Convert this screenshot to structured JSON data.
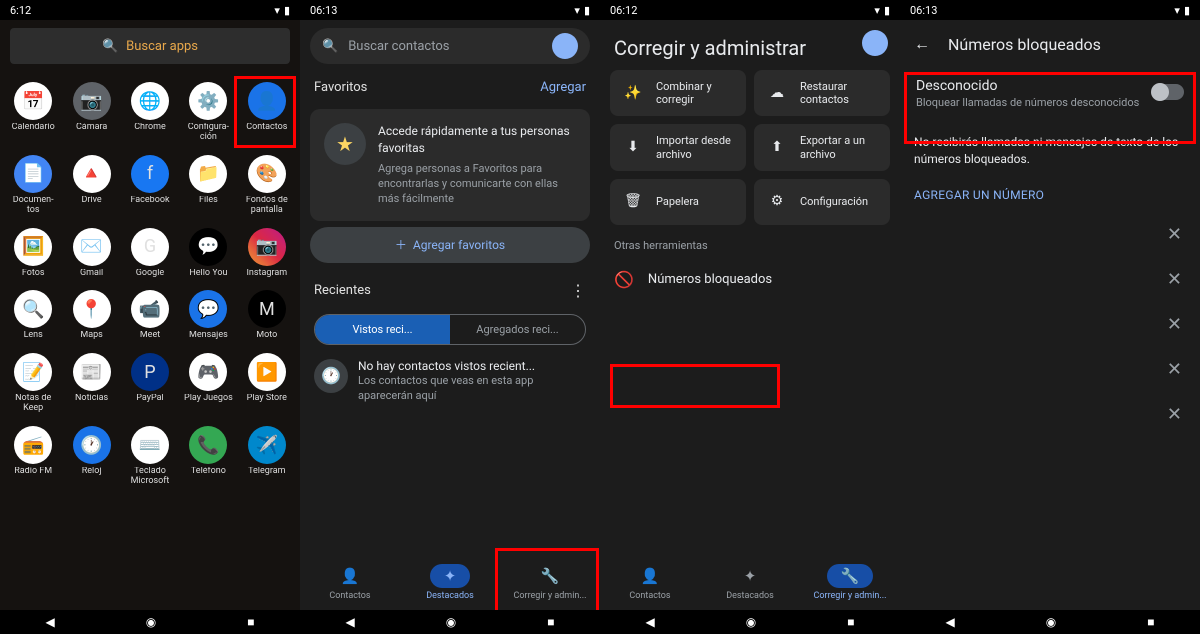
{
  "status": {
    "time1": "6:12",
    "time2": "06:13",
    "time3": "06:12",
    "time4": "06:13"
  },
  "p1": {
    "search": "Buscar apps",
    "apps": [
      {
        "label": "Calendario",
        "bg": "#fff",
        "emoji": "📅"
      },
      {
        "label": "Cámara",
        "bg": "#5f6368",
        "emoji": "📷"
      },
      {
        "label": "Chrome",
        "bg": "#fff",
        "emoji": "🌐"
      },
      {
        "label": "Configura-ción",
        "bg": "#fff",
        "emoji": "⚙️"
      },
      {
        "label": "Contactos",
        "bg": "#1a73e8",
        "emoji": "👤"
      },
      {
        "label": "Documen-tos",
        "bg": "#4285f4",
        "emoji": "📄"
      },
      {
        "label": "Drive",
        "bg": "#fff",
        "emoji": "🔺"
      },
      {
        "label": "Facebook",
        "bg": "#1877f2",
        "emoji": "f"
      },
      {
        "label": "Files",
        "bg": "#fff",
        "emoji": "📁"
      },
      {
        "label": "Fondos de pantalla",
        "bg": "#fff",
        "emoji": "🎨"
      },
      {
        "label": "Fotos",
        "bg": "#fff",
        "emoji": "🖼️"
      },
      {
        "label": "Gmail",
        "bg": "#fff",
        "emoji": "✉️"
      },
      {
        "label": "Google",
        "bg": "#fff",
        "emoji": "G"
      },
      {
        "label": "Hello You",
        "bg": "#000",
        "emoji": "💬"
      },
      {
        "label": "Instagram",
        "bg": "linear-gradient(45deg,#f09433,#e6683c,#dc2743,#cc2366,#bc1888)",
        "emoji": "📷"
      },
      {
        "label": "Lens",
        "bg": "#fff",
        "emoji": "🔍"
      },
      {
        "label": "Maps",
        "bg": "#fff",
        "emoji": "📍"
      },
      {
        "label": "Meet",
        "bg": "#fff",
        "emoji": "📹"
      },
      {
        "label": "Mensajes",
        "bg": "#1a73e8",
        "emoji": "💬"
      },
      {
        "label": "Moto",
        "bg": "#000",
        "emoji": "M"
      },
      {
        "label": "Notas de Keep",
        "bg": "#fff",
        "emoji": "📝"
      },
      {
        "label": "Noticias",
        "bg": "#fff",
        "emoji": "📰"
      },
      {
        "label": "PayPal",
        "bg": "#003087",
        "emoji": "P"
      },
      {
        "label": "Play Juegos",
        "bg": "#fff",
        "emoji": "🎮"
      },
      {
        "label": "Play Store",
        "bg": "#fff",
        "emoji": "▶️"
      },
      {
        "label": "Radio FM",
        "bg": "#fff",
        "emoji": "📻"
      },
      {
        "label": "Reloj",
        "bg": "#1a73e8",
        "emoji": "🕐"
      },
      {
        "label": "Teclado Microsoft",
        "bg": "#fff",
        "emoji": "⌨️"
      },
      {
        "label": "Teléfono",
        "bg": "#34a853",
        "emoji": "📞"
      },
      {
        "label": "Telegram",
        "bg": "#0088cc",
        "emoji": "✈️"
      }
    ]
  },
  "p2": {
    "search_placeholder": "Buscar contactos",
    "favorites": "Favoritos",
    "add": "Agregar",
    "fav_title": "Accede rápidamente a tus personas favoritas",
    "fav_sub": "Agrega personas a Favoritos para encontrarlas y comunicarte con ellas más fácilmente",
    "add_fav": "Agregar favoritos",
    "recent": "Recientes",
    "tab1": "Vistos reci...",
    "tab2": "Agregados reci...",
    "recent_title": "No hay contactos vistos recient...",
    "recent_sub": "Los contactos que veas en esta app aparecerán aquí",
    "nav": [
      "Contactos",
      "Destacados",
      "Corregir y admin..."
    ]
  },
  "p3": {
    "title": "Corregir y administrar",
    "actions": [
      {
        "icon": "✨",
        "label": "Combinar y corregir"
      },
      {
        "icon": "☁",
        "label": "Restaurar contactos"
      },
      {
        "icon": "⬇",
        "label": "Importar desde archivo"
      },
      {
        "icon": "⬆",
        "label": "Exportar a un archivo"
      },
      {
        "icon": "🗑",
        "label": "Papelera"
      },
      {
        "icon": "⚙",
        "label": "Configuración"
      }
    ],
    "other": "Otras herramientas",
    "blocked": "Números bloqueados",
    "nav": [
      "Contactos",
      "Destacados",
      "Corregir y admin..."
    ]
  },
  "p4": {
    "title": "Números bloqueados",
    "unknown_title": "Desconocido",
    "unknown_sub": "Bloquear llamadas de números desconocidos",
    "info": "No recibirás llamadas ni mensajes de texto de los números bloqueados.",
    "add_number": "AGREGAR UN NÚMERO"
  }
}
